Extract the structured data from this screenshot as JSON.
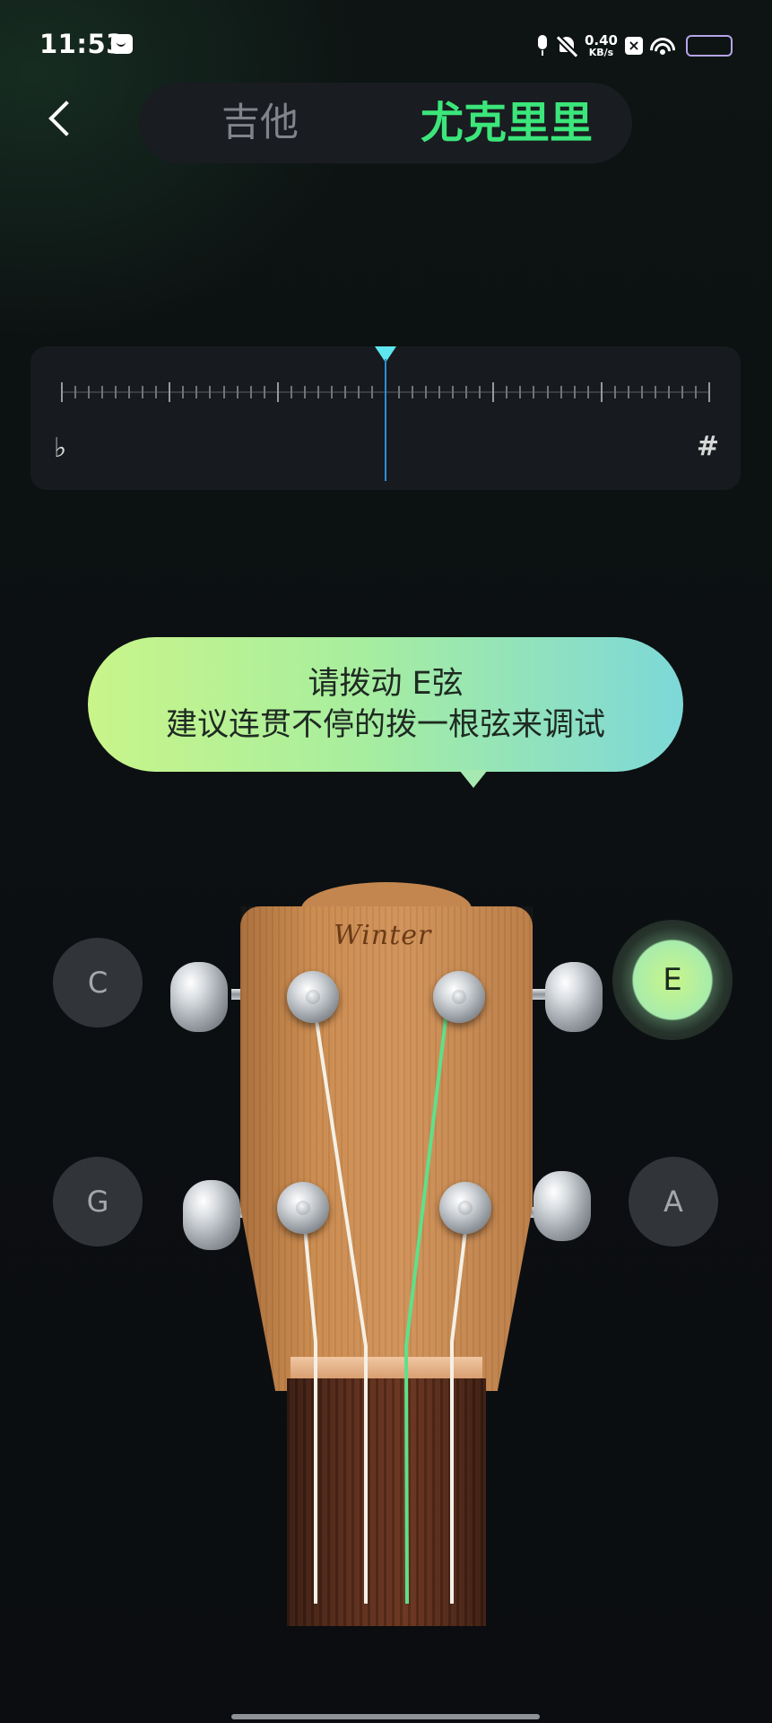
{
  "status_bar": {
    "time": "11:53",
    "net_speed_value": "0.40",
    "net_speed_unit": "KB/s",
    "icons": [
      "message-icon",
      "mic-icon",
      "bell-off-icon",
      "x-box-icon",
      "wifi-icon",
      "battery-icon"
    ]
  },
  "header": {
    "tabs": [
      {
        "label": "吉他",
        "selected": false
      },
      {
        "label": "尤克里里",
        "selected": true
      }
    ]
  },
  "tuner": {
    "flat_symbol": "♭",
    "sharp_symbol": "#",
    "needle_offset": 0
  },
  "prompt": {
    "line1": "请拨动 E弦",
    "line2": "建议连贯不停的拨一根弦来调试"
  },
  "strings": {
    "top_left": "C",
    "top_right": "E",
    "bottom_left": "G",
    "bottom_right": "A",
    "active": "E"
  },
  "headstock": {
    "brand": "Winter"
  },
  "colors": {
    "accent": "#3be67a",
    "active_string": "#5fe08a",
    "needle": "#5ee6ef",
    "background": "#0c1013"
  }
}
